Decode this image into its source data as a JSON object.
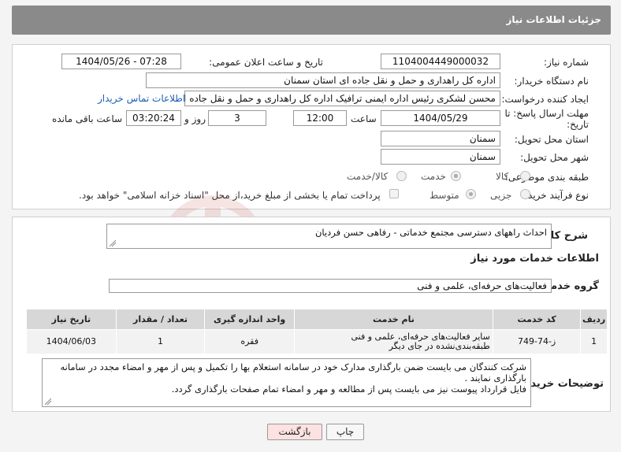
{
  "header": {
    "title": "جزئیات اطلاعات نیاز"
  },
  "form": {
    "need_number": {
      "label": "شماره نیاز:",
      "value": "1104004449000032"
    },
    "announce_datetime": {
      "label": "تاریخ و ساعت اعلان عمومی:",
      "value": "1404/05/26 - 07:28"
    },
    "buyer_org": {
      "label": "نام دستگاه خریدار:",
      "value": "اداره کل راهداری و حمل و نقل جاده ای استان سمنان"
    },
    "requester": {
      "label": "ایجاد کننده درخواست:",
      "value": "محسن لشکری رئیس اداره ایمنی ترافیک اداره کل راهداری و حمل و نقل جاده ای استان سمنان"
    },
    "buyer_contact_link": "اطلاعات تماس خریدار",
    "deadline": {
      "label_line1": "مهلت ارسال پاسخ: تا",
      "label_line2": "تاریخ:",
      "date": "1404/05/29",
      "time_label": "ساعت",
      "time": "12:00",
      "days": "3",
      "days_label": "روز و",
      "remaining": "03:20:24",
      "remaining_label": "ساعت باقی مانده"
    },
    "delivery_province": {
      "label": "استان محل تحویل:",
      "value": "سمنان"
    },
    "delivery_city": {
      "label": "شهر محل تحویل:",
      "value": "سمنان"
    },
    "category": {
      "label": "طبقه بندی موضوعی:",
      "options": [
        "کالا",
        "خدمت",
        "کالا/خدمت"
      ],
      "selected": "خدمت"
    },
    "purchase_type": {
      "label": "نوع فرآیند خرید :",
      "options": [
        "جزیی",
        "متوسط"
      ],
      "selected": "متوسط",
      "payment_note": "پرداخت تمام یا بخشی از مبلغ خرید،از محل \"اسناد خزانه اسلامی\" خواهد بود."
    }
  },
  "summary": {
    "label": "شرح کلی نیاز:",
    "value": "احداث راههای دسترسی مجتمع خدماتی - رفاهی حسن فردیان"
  },
  "services": {
    "section_title": "اطلاعات خدمات مورد نیاز",
    "group_label": "گروه خدمت:",
    "group_value": "فعالیت‌های حرفه‌ای، علمی و فنی",
    "columns": [
      "ردیف",
      "کد خدمت",
      "نام خدمت",
      "واحد اندازه گیری",
      "تعداد / مقدار",
      "تاریخ نیاز"
    ],
    "rows": [
      {
        "index": "1",
        "code": "ز-74-749",
        "name": "سایر فعالیت‌های حرفه‌ای، علمی و فنی طبقه‌بندی‌نشده در جای دیگر",
        "unit": "فقره",
        "qty": "1",
        "date": "1404/06/03"
      }
    ]
  },
  "buyer_notes": {
    "label": "توضیحات خریدار:",
    "line1": "شرکت کنندگان می بایست ضمن بارگذاری مدارک خود در سامانه استعلام بها را تکمیل و پس از مهر و امضاء مجدد در سامانه",
    "line2": "بارگذاری نمایند .",
    "line3": "فایل قرارداد پیوست نیز می بایست پس از مطالعه و مهر و امضاء تمام صفحات بارگذاری گردد."
  },
  "buttons": {
    "print": "چاپ",
    "back": "بازگشت"
  },
  "colors": {
    "header": "#8a8a8a",
    "link": "#1a5fb4",
    "back_button": "#fde2e2"
  }
}
